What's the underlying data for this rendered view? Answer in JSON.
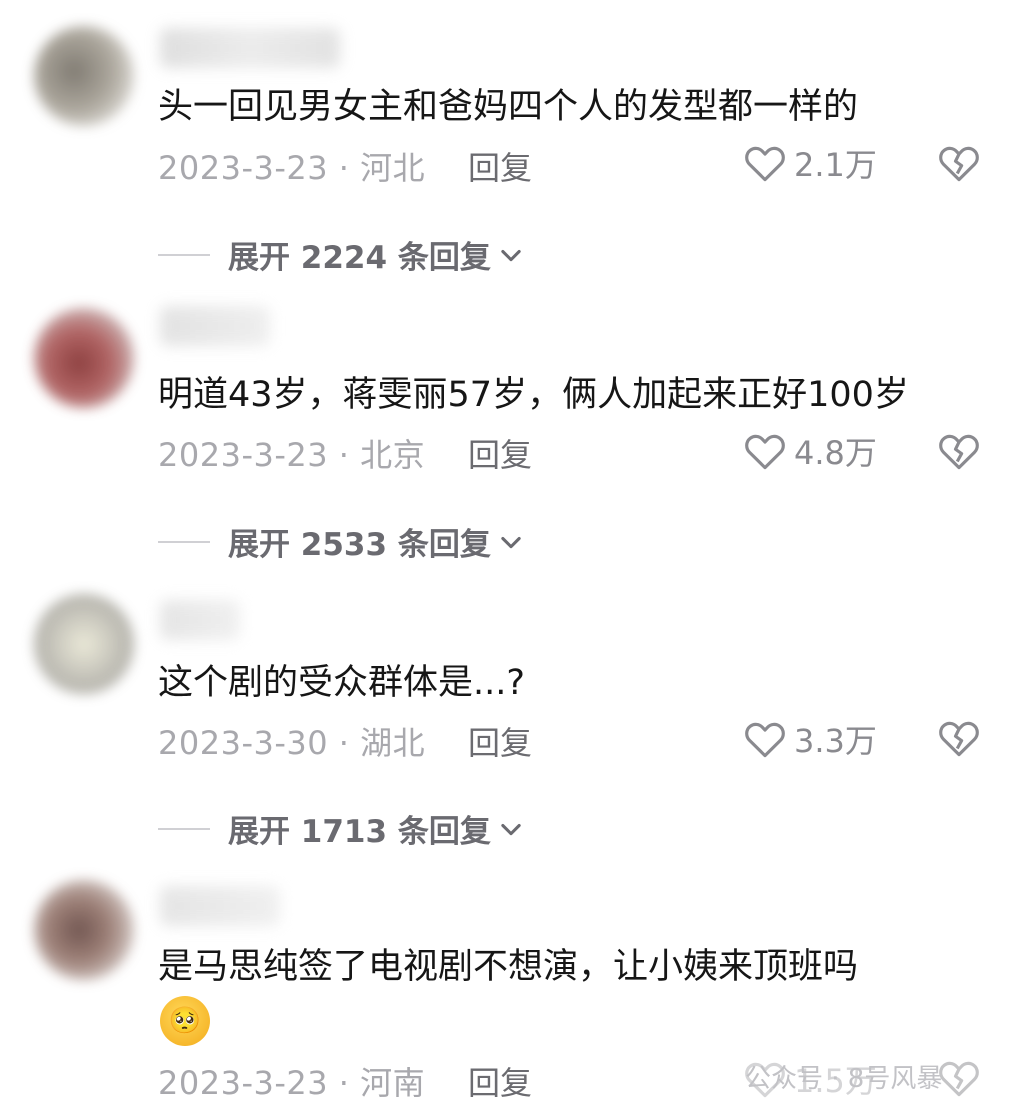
{
  "comments": [
    {
      "text": "头一回见男女主和爸妈四个人的发型都一样的",
      "date_location": "2023-3-23 · 河北",
      "reply_label": "回复",
      "likes": "2.1万",
      "expand_label": "展开 2224 条回复",
      "avatar_color": "#8a8478"
    },
    {
      "text": "明道43岁，蒋雯丽57岁，俩人加起来正好100岁",
      "date_location": "2023-3-23 · 北京",
      "reply_label": "回复",
      "likes": "4.8万",
      "expand_label": "展开 2533 条回复",
      "avatar_color": "#8c3a3a"
    },
    {
      "text": "这个剧的受众群体是...?",
      "date_location": "2023-3-30 · 湖北",
      "reply_label": "回复",
      "likes": "3.3万",
      "expand_label": "展开 1713 条回复",
      "avatar_color": "#c9c6b4"
    },
    {
      "text": "是马思纯签了电视剧不想演，让小姨来顶班吗",
      "emoji": "🥺",
      "date_location": "2023-3-23 · 河南",
      "reply_label": "回复",
      "likes": "1.5万",
      "avatar_color": "#7a5a50"
    }
  ],
  "watermark": "公众号 · 8号风暴",
  "icons": {
    "like": "heart-outline-icon",
    "dislike": "broken-heart-icon",
    "expand": "chevron-down-icon"
  }
}
